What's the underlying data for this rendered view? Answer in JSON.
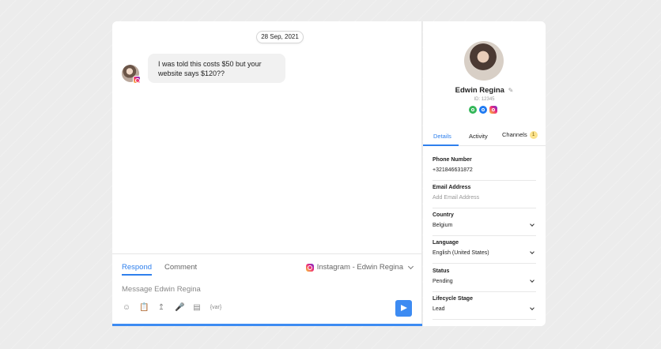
{
  "chat": {
    "date": "28 Sep, 2021",
    "message_line1": "I was told this costs $50 but your",
    "message_line2": "website says $120??"
  },
  "composer": {
    "respond_tab": "Respond",
    "comment_tab": "Comment",
    "channel": "Instagram - Edwin Regina",
    "placeholder": "Message Edwin Regina",
    "variable_tool": "{var}"
  },
  "profile": {
    "name": "Edwin Regina",
    "id": "ID: 12345",
    "tabs": {
      "details": "Details",
      "activity": "Activity",
      "channels": "Channels",
      "channels_badge": "1"
    },
    "fields": [
      {
        "label": "Phone Number",
        "value": "+321846631872"
      },
      {
        "label": "Email Address",
        "value": "Add Email Address"
      },
      {
        "label": "Country",
        "value": "Belgium"
      },
      {
        "label": "Language",
        "value": "English (United States)"
      },
      {
        "label": "Status",
        "value": "Pending"
      },
      {
        "label": "Lifecycle Stage",
        "value": "Lead"
      }
    ]
  },
  "colors": {
    "accent": "#3d8bf2",
    "background": "#ececec"
  }
}
